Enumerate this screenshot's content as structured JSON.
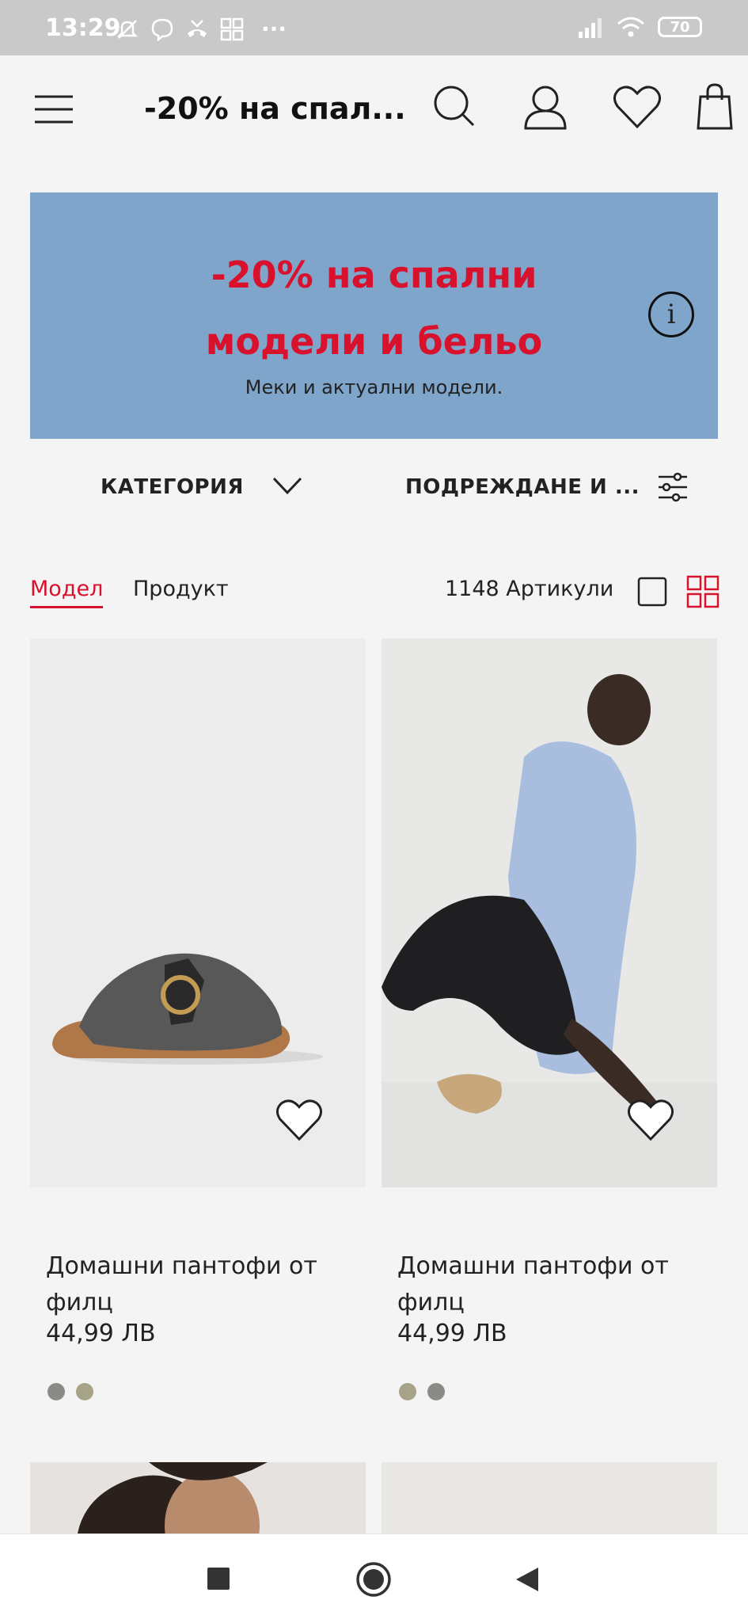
{
  "status_bar": {
    "time": "13:29",
    "battery": "70",
    "overflow": "···"
  },
  "header": {
    "title": "-20% на спал..."
  },
  "banner": {
    "headline_line1": "-20% на спални",
    "headline_line2": "модели и бельо",
    "subtitle": "Меки и актуални модели.",
    "info_symbol": "i",
    "bg_color": "#7fa5cb",
    "accent_color": "#d8112d"
  },
  "filters": {
    "category_label": "КАТЕГОРИЯ",
    "sort_label": "ПОДРЕЖДАНЕ И ..."
  },
  "view": {
    "tab_model": "Модел",
    "tab_product": "Продукт",
    "item_count": "1148 Артикули",
    "active_tab": "Модел"
  },
  "products": [
    {
      "name": "Домашни пантофи от филц",
      "price": "44,99 ЛВ",
      "swatches": [
        "#8a8a86",
        "#a7a389"
      ]
    },
    {
      "name": "Домашни пантофи от филц",
      "price": "44,99 ЛВ",
      "swatches": [
        "#a7a389",
        "#8a8a86"
      ]
    }
  ]
}
